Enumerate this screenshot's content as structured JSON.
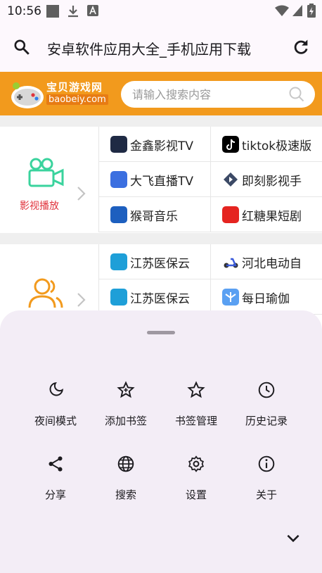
{
  "status_bar": {
    "time": "10:56"
  },
  "toolbar": {
    "page_title": "安卓软件应用大全_手机应用下载",
    "search_icon": "search-icon",
    "refresh_icon": "refresh-icon"
  },
  "site": {
    "brand_cn": "宝贝游戏网",
    "brand_en": "baobeiy.com",
    "search_placeholder": "请输入搜索内容",
    "accent_color": "#f29a1d"
  },
  "categories": [
    {
      "label": "影视播放",
      "icon": "video-camera-icon",
      "apps": [
        "金鑫影视TV",
        "tiktok极速版",
        "大飞直播TV",
        "即刻影视手",
        "猴哥音乐",
        "红糖果短剧"
      ]
    },
    {
      "label": "",
      "icon": "users-icon",
      "apps": [
        "江苏医保云",
        "河北电动自",
        "江苏医保云",
        "每日瑜伽"
      ]
    }
  ],
  "menu": {
    "items": [
      {
        "label": "夜间模式",
        "icon": "moon-icon"
      },
      {
        "label": "添加书签",
        "icon": "star-add-icon"
      },
      {
        "label": "书签管理",
        "icon": "star-icon"
      },
      {
        "label": "历史记录",
        "icon": "clock-icon"
      },
      {
        "label": "分享",
        "icon": "share-icon"
      },
      {
        "label": "搜索",
        "icon": "globe-icon"
      },
      {
        "label": "设置",
        "icon": "gear-icon"
      },
      {
        "label": "关于",
        "icon": "info-icon"
      }
    ],
    "collapse_icon": "chevron-down-icon"
  }
}
